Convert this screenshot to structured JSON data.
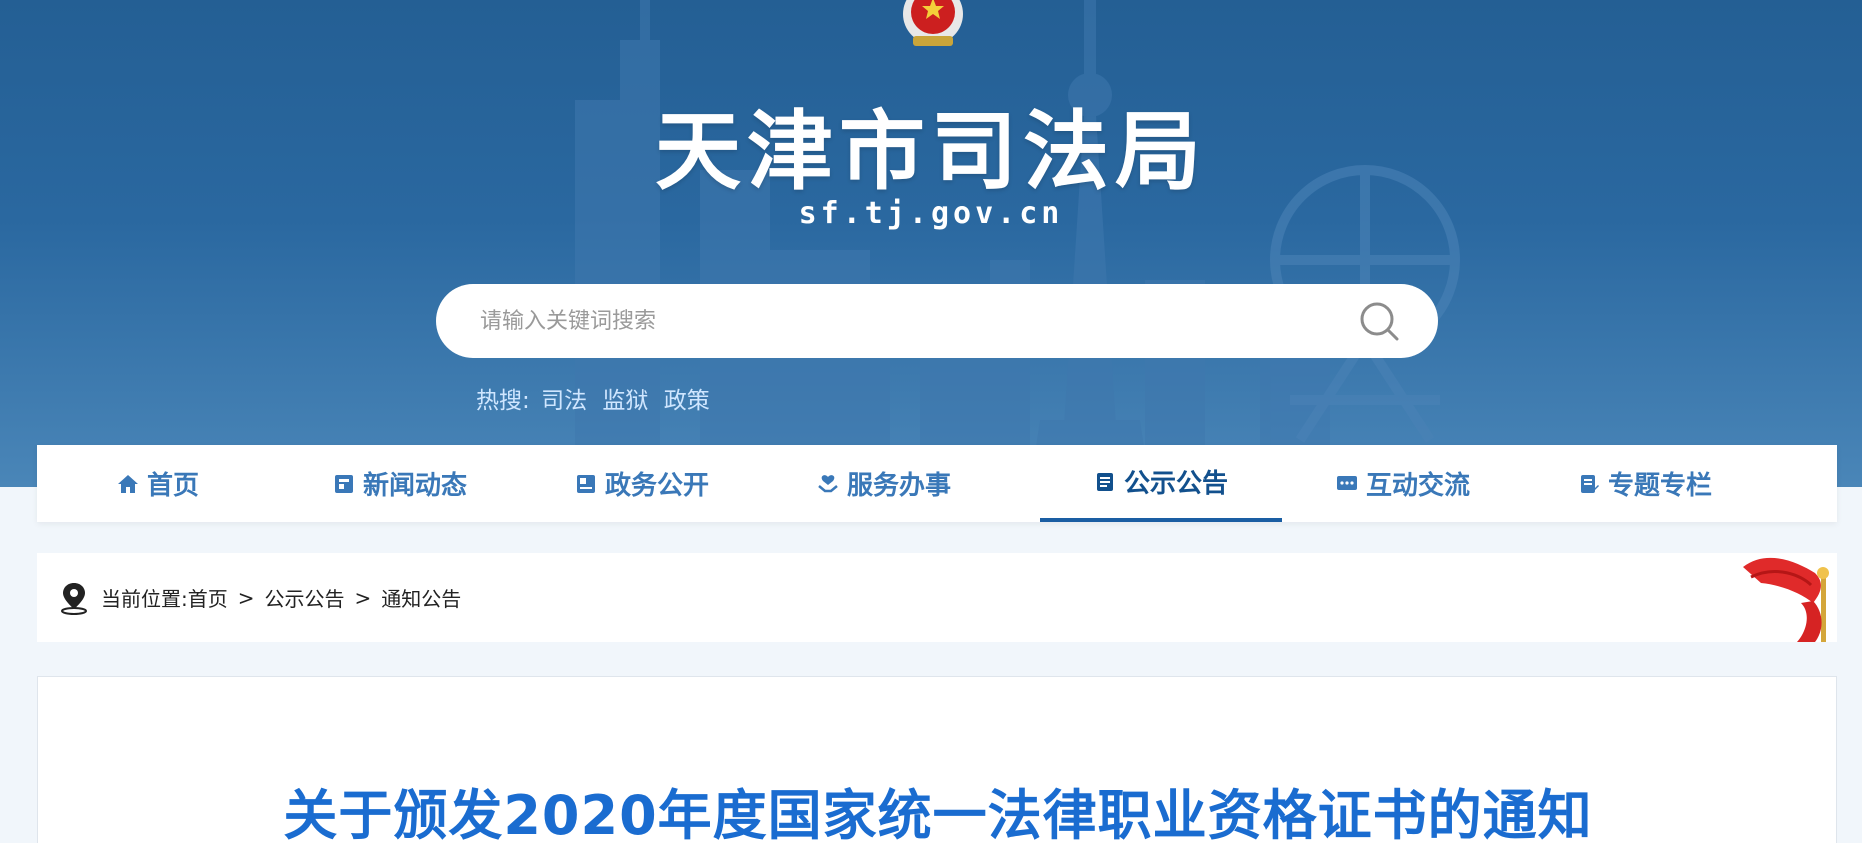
{
  "header": {
    "site_title": "天津市司法局",
    "site_domain": "sf.tj.gov.cn",
    "emblem_icon": "national-emblem-icon"
  },
  "search": {
    "placeholder": "请输入关键词搜索",
    "value": "",
    "button_icon": "search-icon"
  },
  "hot_search": {
    "label": "热搜:",
    "terms": [
      "司法",
      "监狱",
      "政策"
    ]
  },
  "nav": {
    "items": [
      {
        "label": "首页",
        "icon": "home-icon"
      },
      {
        "label": "新闻动态",
        "icon": "news-icon"
      },
      {
        "label": "政务公开",
        "icon": "document-icon"
      },
      {
        "label": "服务办事",
        "icon": "service-hand-icon"
      },
      {
        "label": "公示公告",
        "icon": "notice-book-icon"
      },
      {
        "label": "互动交流",
        "icon": "chat-icon"
      },
      {
        "label": "专题专栏",
        "icon": "edit-doc-icon"
      }
    ],
    "active_index": 4
  },
  "breadcrumb": {
    "prefix": "当前位置:",
    "items": [
      "首页",
      "公示公告",
      "通知公告"
    ],
    "separator": ">",
    "icon": "location-pin-icon"
  },
  "article": {
    "title": "关于颁发2020年度国家统一法律职业资格证书的通知"
  },
  "colors": {
    "banner": "#2a68a0",
    "nav_text": "#3a78b8",
    "nav_active": "#12508d",
    "title_blue": "#1a6cd0",
    "page_bg": "#f1f6fb"
  }
}
